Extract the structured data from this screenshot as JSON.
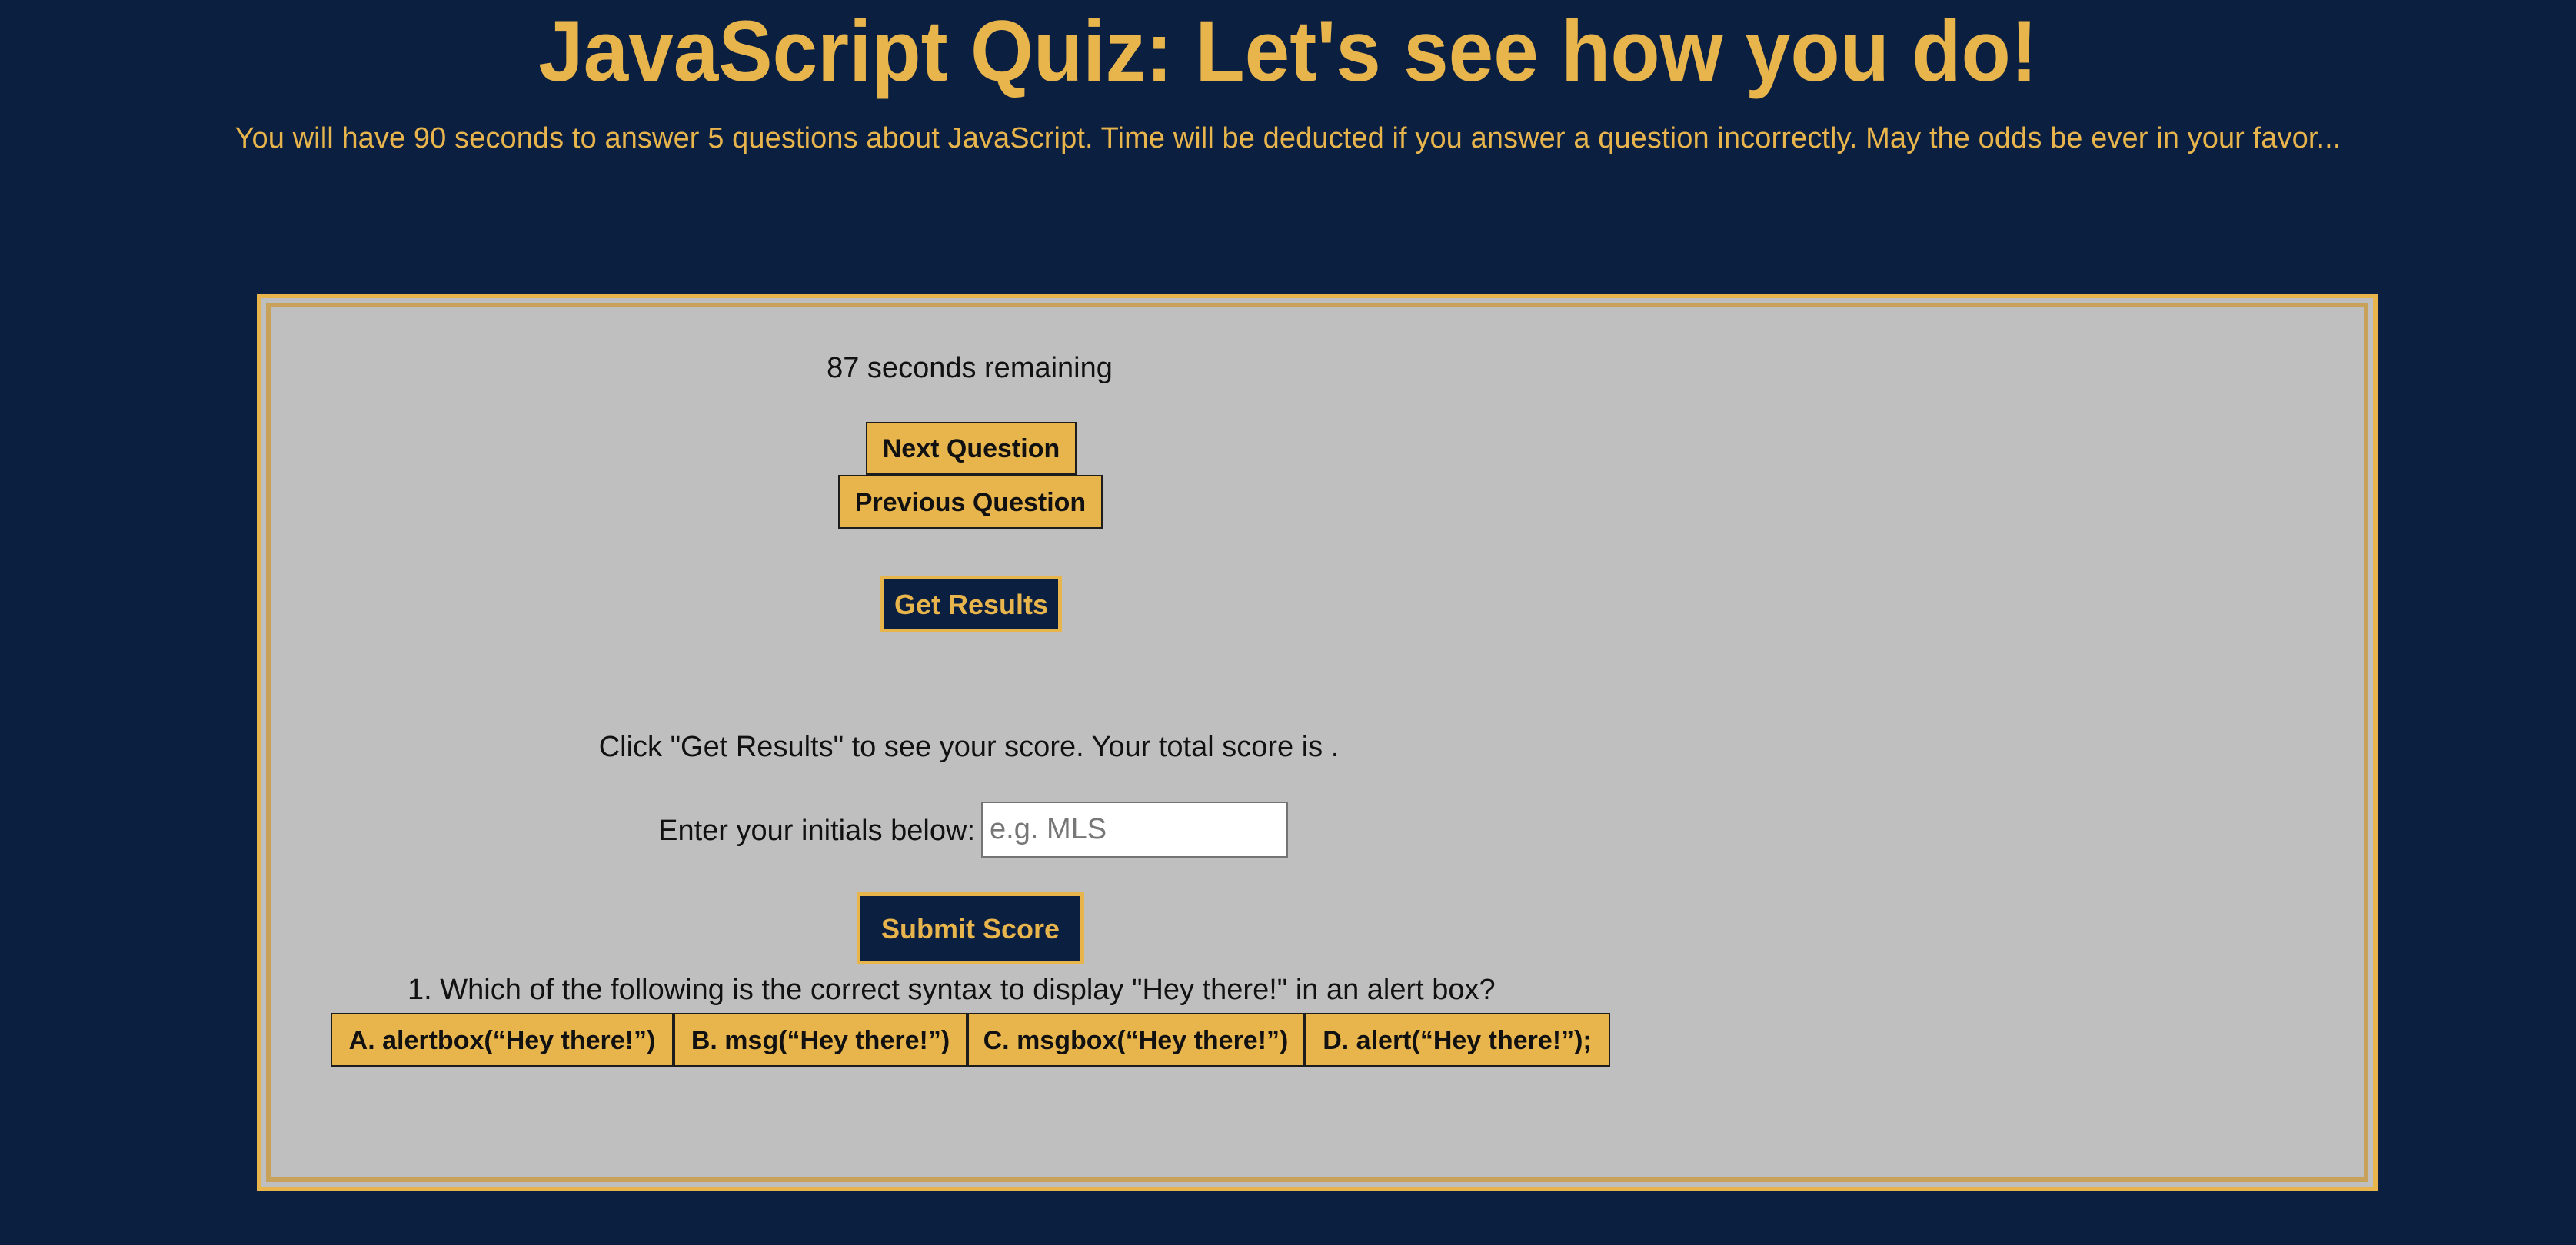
{
  "header": {
    "title": "JavaScript Quiz: Let's see how you do!",
    "subtitle": "You will have 90 seconds to answer 5 questions about JavaScript. Time will be deducted if you answer a question incorrectly. May the odds be ever in your favor..."
  },
  "quiz": {
    "timer_text": "87 seconds remaining",
    "buttons": {
      "next_label": "Next Question",
      "previous_label": "Previous Question",
      "results_label": "Get Results",
      "submit_label": "Submit Score"
    },
    "score_message": "Click \"Get Results\" to see your score. Your total score is .",
    "initials": {
      "label": "Enter your initials below:",
      "value": "",
      "placeholder": "e.g. MLS"
    },
    "question": {
      "text": "1. Which of the following is the correct syntax to display \"Hey there!\" in an alert box?",
      "answers": [
        {
          "label": "A. alertbox(“Hey there!”)"
        },
        {
          "label": "B. msg(“Hey there!”)"
        },
        {
          "label": "C. msgbox(“Hey there!”)"
        },
        {
          "label": "D. alert(“Hey there!”);"
        }
      ]
    }
  },
  "theme": {
    "background": "#0b1f41",
    "accent": "#e8b54c",
    "panel": "#bfbfbf"
  }
}
